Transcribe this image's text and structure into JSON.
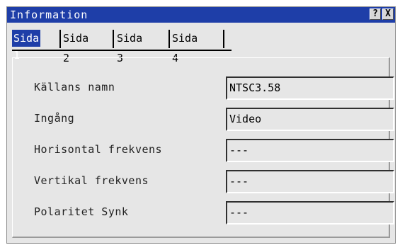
{
  "window": {
    "title": "Information"
  },
  "titlebar": {
    "help_label": "?",
    "close_label": "X"
  },
  "tabs": [
    {
      "label": "Sida 1",
      "active": true
    },
    {
      "label": "Sida 2",
      "active": false
    },
    {
      "label": "Sida 3",
      "active": false
    },
    {
      "label": "Sida 4",
      "active": false
    }
  ],
  "fields": [
    {
      "label": "Källans namn",
      "value": "NTSC3.58"
    },
    {
      "label": "Ingång",
      "value": "Video"
    },
    {
      "label": "Horisontal frekvens",
      "value": "---"
    },
    {
      "label": "Vertikal frekvens",
      "value": "---"
    },
    {
      "label": "Polaritet Synk",
      "value": "---"
    }
  ],
  "colors": {
    "titlebar": "#1e3ea8",
    "background": "#e6e6e6",
    "active_tab": "#1e3ea8"
  }
}
